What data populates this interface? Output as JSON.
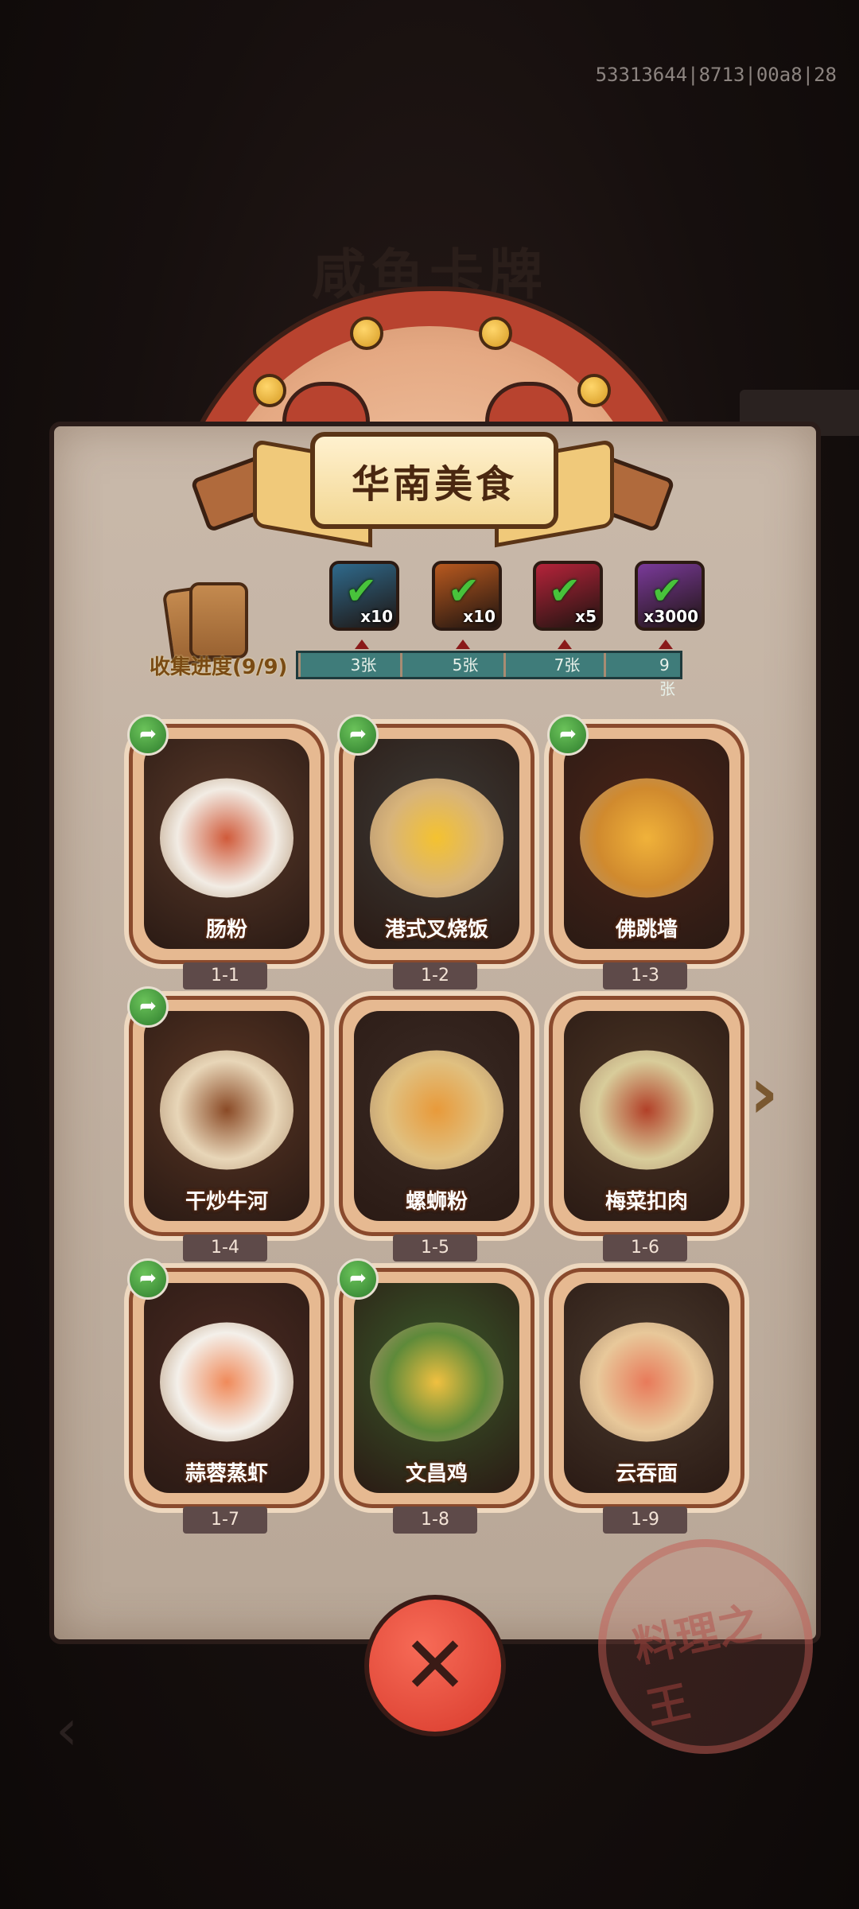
{
  "debug_id": "53313644|8713|00a8|28",
  "background_title": "咸鱼卡牌",
  "banner_title": "华南美食",
  "collection": {
    "label": "收集进度(9/9)",
    "milestones": [
      {
        "threshold": "3张",
        "reward_qty": "x10",
        "reward_icon": "chest-icon",
        "color": "#2f6a8c",
        "claimed": true
      },
      {
        "threshold": "5张",
        "reward_qty": "x10",
        "reward_icon": "key-icon",
        "color": "#b8591f",
        "claimed": true
      },
      {
        "threshold": "7张",
        "reward_qty": "x5",
        "reward_icon": "orb-icon",
        "color": "#b5233a",
        "claimed": true
      },
      {
        "threshold": "9张",
        "reward_qty": "x3000",
        "reward_icon": "gem-icon",
        "color": "#7a3a9a",
        "claimed": true
      }
    ]
  },
  "cards": [
    {
      "name": "肠粉",
      "number": "1-1",
      "shareable": true,
      "art": "rice-roll"
    },
    {
      "name": "港式叉烧饭",
      "number": "1-2",
      "shareable": true,
      "art": "bbq-pork-rice"
    },
    {
      "name": "佛跳墙",
      "number": "1-3",
      "shareable": true,
      "art": "buddha-soup"
    },
    {
      "name": "干炒牛河",
      "number": "1-4",
      "shareable": true,
      "art": "beef-noodles"
    },
    {
      "name": "螺蛳粉",
      "number": "1-5",
      "shareable": false,
      "art": "snail-noodles"
    },
    {
      "name": "梅菜扣肉",
      "number": "1-6",
      "shareable": false,
      "art": "braised-pork"
    },
    {
      "name": "蒜蓉蒸虾",
      "number": "1-7",
      "shareable": true,
      "art": "garlic-shrimp"
    },
    {
      "name": "文昌鸡",
      "number": "1-8",
      "shareable": true,
      "art": "wenchang-chicken"
    },
    {
      "name": "云吞面",
      "number": "1-9",
      "shareable": false,
      "art": "wonton-noodles"
    }
  ],
  "stamp_text": "料理之王",
  "icons": {
    "share": "share-icon",
    "next": "next-arrow-icon",
    "close": "close-icon",
    "back": "back-arrow-icon"
  }
}
